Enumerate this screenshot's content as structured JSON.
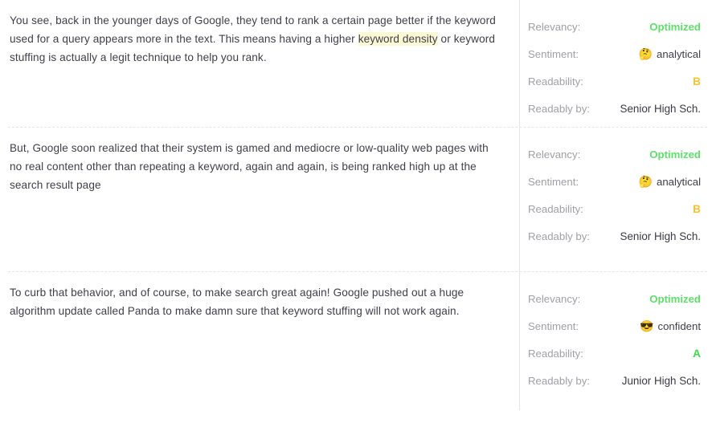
{
  "colors": {
    "relevancy_optimized": "#5ce06a",
    "grade_b": "#fbc02d",
    "grade_a": "#3fd94f",
    "label_gray": "#a0a0a6",
    "body_text": "#3f3f4a",
    "highlight": "#fbf8d4",
    "divider": "#e6e6e9"
  },
  "labels": {
    "relevancy": "Relevancy:",
    "sentiment": "Sentiment:",
    "readability": "Readability:",
    "readably_by": "Readably by:"
  },
  "blocks": [
    {
      "text_before_highlight": "You see, back in the younger days of Google, they tend to rank a certain page better if the keyword used for a query appears more in the text. This means having a higher ",
      "highlight": "keyword density",
      "text_after_highlight": " or keyword stuffing is actually a legit technique to help you rank.",
      "metrics": {
        "relevancy": "Optimized",
        "sentiment": "analytical",
        "sentiment_emoji": "🤔",
        "sentiment_icon_name": "thinking-face-emoji",
        "readability": "B",
        "readability_color": "amber",
        "readably_by": "Senior High Sch."
      }
    },
    {
      "text_before_highlight": "But, Google soon realized that their system is gamed and mediocre or low-quality web pages with no real content other than repeating a keyword, again and again, is being ranked high up at the search result page",
      "highlight": "",
      "text_after_highlight": "",
      "metrics": {
        "relevancy": "Optimized",
        "sentiment": "analytical",
        "sentiment_emoji": "🤔",
        "sentiment_icon_name": "thinking-face-emoji",
        "readability": "B",
        "readability_color": "amber",
        "readably_by": "Senior High Sch."
      }
    },
    {
      "text_before_highlight": "To curb that behavior, and of course, to make search great again! Google pushed out a huge algorithm update called Panda to make damn sure that keyword stuffing will not work again.",
      "highlight": "",
      "text_after_highlight": "",
      "metrics": {
        "relevancy": "Optimized",
        "sentiment": "confident",
        "sentiment_emoji": "😎",
        "sentiment_icon_name": "sunglasses-face-emoji",
        "readability": "A",
        "readability_color": "green",
        "readably_by": "Junior High Sch."
      }
    }
  ]
}
